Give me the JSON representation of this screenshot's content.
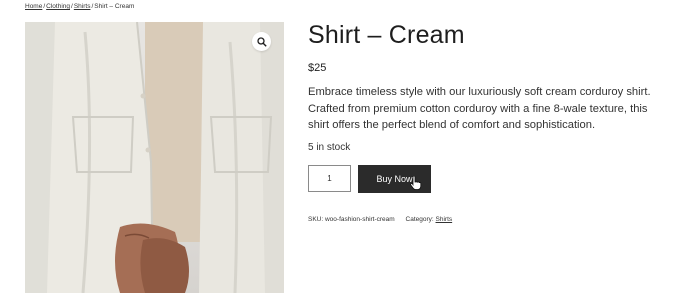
{
  "breadcrumb": {
    "items": [
      "Home",
      "Clothing",
      "Shirts"
    ],
    "separator": "/",
    "current": "Shirt – Cream"
  },
  "product": {
    "title": "Shirt – Cream",
    "price": "$25",
    "description": "Embrace timeless style with our luxuriously soft cream corduroy shirt. Crafted from premium cotton corduroy with a fine 8-wale texture, this shirt offers the perfect blend of comfort and sophistication.",
    "stock": "5 in stock",
    "quantity": "1",
    "buy_label": "Buy Now",
    "sku_label": "SKU:",
    "sku": "woo-fashion-shirt-cream",
    "category_label": "Category:",
    "category": "Shirts"
  },
  "icons": {
    "zoom": "magnifier-icon",
    "cursor": "hand-pointer-icon"
  },
  "colors": {
    "button_bg": "#2b2b2b",
    "shirt": "#ecebe4",
    "undershirt": "#d9c9b4",
    "skin": "#a56e55"
  }
}
